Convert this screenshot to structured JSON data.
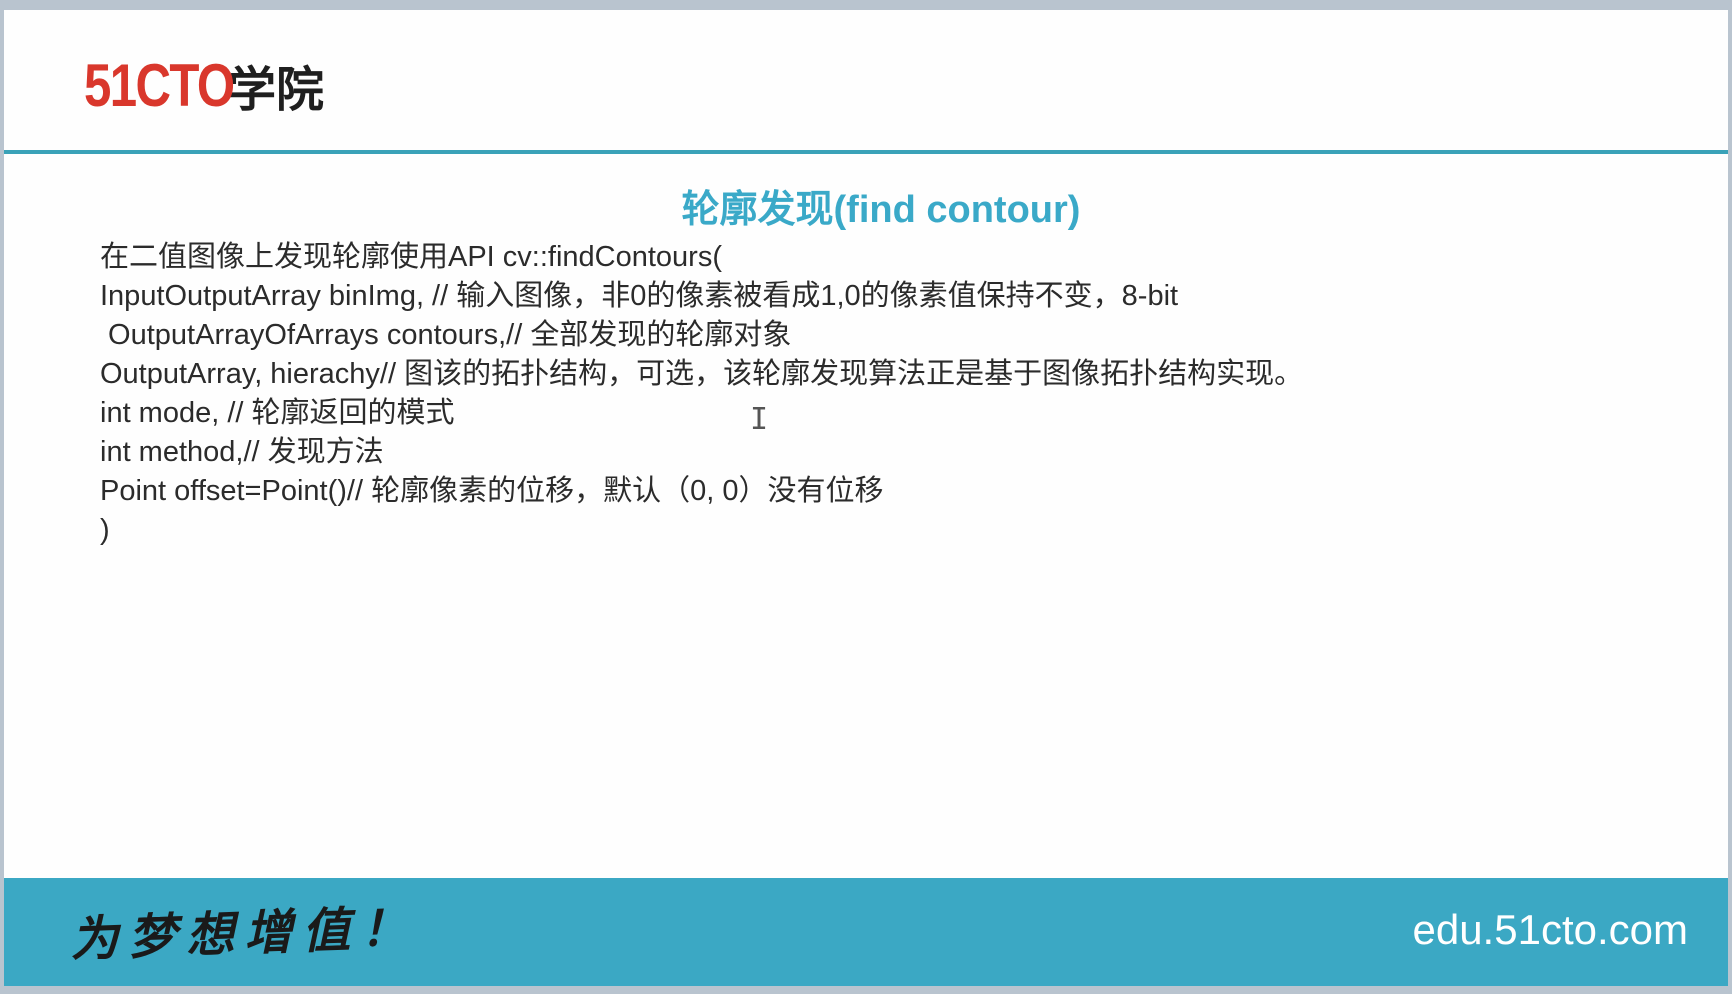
{
  "logo": {
    "number": "51CTO",
    "name": "学院"
  },
  "slide": {
    "title": "轮廓发现(find contour)",
    "lines": [
      "在二值图像上发现轮廓使用API cv::findContours(",
      "InputOutputArray binImg, // 输入图像，非0的像素被看成1,0的像素值保持不变，8-bit",
      " OutputArrayOfArrays contours,// 全部发现的轮廓对象",
      "OutputArray, hierachy// 图该的拓扑结构，可选，该轮廓发现算法正是基于图像拓扑结构实现。",
      "int mode, // 轮廓返回的模式",
      "int method,// 发现方法",
      "Point offset=Point()// 轮廓像素的位移，默认（0, 0）没有位移",
      ")"
    ]
  },
  "footer": {
    "slogan": "为梦想增值！",
    "site": "edu.51cto.com"
  },
  "cursor_icon": "text-cursor-icon",
  "colors": {
    "accent": "#3aa9c8",
    "logo_red": "#d9372c",
    "footer_bg": "#3ba8c4"
  }
}
